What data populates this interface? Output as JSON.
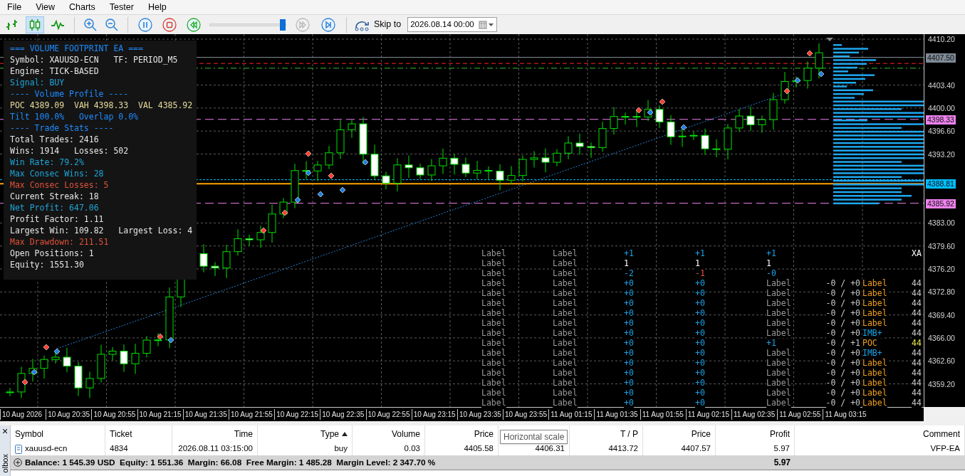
{
  "menu": [
    "File",
    "View",
    "Charts",
    "Tester",
    "Help"
  ],
  "toolbar": {
    "chart_types": [
      {
        "kind": "bars",
        "selected": false
      },
      {
        "kind": "candles",
        "selected": true
      },
      {
        "kind": "line",
        "selected": false
      }
    ],
    "playback": [
      {
        "kind": "pause",
        "disabled": false
      },
      {
        "kind": "stop",
        "disabled": false
      },
      {
        "kind": "rewind",
        "disabled": false
      }
    ],
    "speed": {
      "level": 0.95
    },
    "steps": [
      {
        "kind": "fast-forward",
        "disabled": true
      },
      {
        "kind": "step-end",
        "disabled": false
      }
    ],
    "skip_label": "Skip to",
    "skip_date": "2026.08.14 00:00"
  },
  "info_panel": [
    {
      "text": "=== VOLUME FOOTPRINT EA ===",
      "color": "#1e8cff"
    },
    {
      "text": "Symbol: XAUUSD-ECN   TF: PERIOD_M5",
      "color": "#e6e6e6"
    },
    {
      "text": "Engine: TICK-BASED",
      "color": "#e6e6e6"
    },
    {
      "text": "Signal: BUY",
      "color": "#1ea5d8"
    },
    {
      "text": "---- Volume Profile ----",
      "color": "#1e8cff"
    },
    {
      "text": "POC 4389.09  VAH 4398.33  VAL 4385.92",
      "color": "#e6dc9c"
    },
    {
      "text": "Tilt 100.0%   Overlap 0.0%",
      "color": "#1e8cff"
    },
    {
      "text": "---- Trade Stats ----",
      "color": "#1e8cff"
    },
    {
      "text": "Total Trades: 2416",
      "color": "#e6e6e6"
    },
    {
      "text": "Wins: 1914   Losses: 502",
      "color": "#e6e6e6"
    },
    {
      "text": "Win Rate: 79.2%",
      "color": "#1ea5d8"
    },
    {
      "text": "Max Consec Wins: 28",
      "color": "#1ea5d8"
    },
    {
      "text": "Max Consec Losses: 5",
      "color": "#e0523a"
    },
    {
      "text": "Current Streak: 18",
      "color": "#e6e6e6"
    },
    {
      "text": "Net Profit: 647.06",
      "color": "#1ea5d8"
    },
    {
      "text": "Profit Factor: 1.11",
      "color": "#e6e6e6"
    },
    {
      "text": "Largest Win: 109.82   Largest Loss: 4",
      "color": "#e6e6e6"
    },
    {
      "text": "Max Drawdown: 211.51",
      "color": "#e0523a"
    },
    {
      "text": "Open Positions: 1",
      "color": "#e6e6e6"
    },
    {
      "text": "Equity: 1551.30",
      "color": "#e6e6e6"
    }
  ],
  "label_grid": [
    {
      "column_1": {
        "text": "Label",
        "color": "#9a9a9a"
      },
      "column_2": {
        "text": "Label",
        "color": "#9a9a9a"
      },
      "column_3": {
        "text": "+1",
        "color": "#1aa3e8"
      },
      "column_4": {
        "text": "+1",
        "color": "#1aa3e8"
      },
      "column_5": {
        "text": "+1",
        "color": "#1aa3e8"
      },
      "column_8": {
        "text": "XA",
        "color": "#ffffff"
      }
    },
    {
      "column_1": {
        "text": "Label",
        "color": "#9a9a9a"
      },
      "column_2": {
        "text": "Label",
        "color": "#9a9a9a"
      },
      "column_3": {
        "text": "1",
        "color": "#ffffff"
      },
      "column_4": {
        "text": "1",
        "color": "#ffffff"
      },
      "column_5": {
        "text": "1",
        "color": "#ffffff"
      }
    },
    {
      "column_1": {
        "text": "Label",
        "color": "#9a9a9a"
      },
      "column_2": {
        "text": "Label",
        "color": "#9a9a9a"
      },
      "column_3": {
        "text": "-2",
        "color": "#1aa3e8"
      },
      "column_4": {
        "text": "-1",
        "color": "#e8543a"
      },
      "column_5": {
        "text": "-0",
        "color": "#1aa3e8"
      }
    },
    {
      "column_1": {
        "text": "Label",
        "color": "#9a9a9a"
      },
      "column_2": {
        "text": "Label",
        "color": "#9a9a9a"
      },
      "column_3": {
        "text": "+0",
        "color": "#1aa3e8"
      },
      "column_4": {
        "text": "+0",
        "color": "#1aa3e8"
      },
      "column_5": {
        "text": "Label",
        "color": "#9a9a9a"
      },
      "column_6": {
        "text": "-0 / +0",
        "color": "#c8c8c8"
      },
      "column_7": {
        "text": "Label",
        "color": "#f0a020"
      },
      "column_8": {
        "text": "44",
        "color": "#c8c8c8"
      }
    },
    {
      "column_1": {
        "text": "Label",
        "color": "#9a9a9a"
      },
      "column_2": {
        "text": "Label",
        "color": "#9a9a9a"
      },
      "column_3": {
        "text": "+0",
        "color": "#1aa3e8"
      },
      "column_4": {
        "text": "+0",
        "color": "#1aa3e8"
      },
      "column_5": {
        "text": "Label",
        "color": "#9a9a9a"
      },
      "column_6": {
        "text": "-0 / +0",
        "color": "#c8c8c8"
      },
      "column_7": {
        "text": "Label",
        "color": "#f0a020"
      },
      "column_8": {
        "text": "44",
        "color": "#c8c8c8"
      }
    },
    {
      "column_1": {
        "text": "Label",
        "color": "#9a9a9a"
      },
      "column_2": {
        "text": "Label",
        "color": "#9a9a9a"
      },
      "column_3": {
        "text": "+0",
        "color": "#1aa3e8"
      },
      "column_4": {
        "text": "+0",
        "color": "#1aa3e8"
      },
      "column_5": {
        "text": "Label",
        "color": "#9a9a9a"
      },
      "column_6": {
        "text": "-0 / +0",
        "color": "#c8c8c8"
      },
      "column_7": {
        "text": "Label",
        "color": "#f0a020"
      },
      "column_8": {
        "text": "44",
        "color": "#c8c8c8"
      }
    },
    {
      "column_1": {
        "text": "Label",
        "color": "#9a9a9a"
      },
      "column_2": {
        "text": "Label",
        "color": "#9a9a9a"
      },
      "column_3": {
        "text": "+0",
        "color": "#1aa3e8"
      },
      "column_4": {
        "text": "+0",
        "color": "#1aa3e8"
      },
      "column_5": {
        "text": "Label",
        "color": "#9a9a9a"
      },
      "column_6": {
        "text": "-0 / +0",
        "color": "#c8c8c8"
      },
      "column_7": {
        "text": "Label",
        "color": "#f0a020"
      },
      "column_8": {
        "text": "44",
        "color": "#c8c8c8"
      }
    },
    {
      "column_1": {
        "text": "Label",
        "color": "#9a9a9a"
      },
      "column_2": {
        "text": "Label",
        "color": "#9a9a9a"
      },
      "column_3": {
        "text": "+0",
        "color": "#1aa3e8"
      },
      "column_4": {
        "text": "+0",
        "color": "#1aa3e8"
      },
      "column_5": {
        "text": "Label",
        "color": "#9a9a9a"
      },
      "column_6": {
        "text": "-0 / +0",
        "color": "#c8c8c8"
      },
      "column_7": {
        "text": "Label",
        "color": "#f0a020"
      },
      "column_8": {
        "text": "44",
        "color": "#c8c8c8"
      }
    },
    {
      "column_1": {
        "text": "Label",
        "color": "#9a9a9a"
      },
      "column_2": {
        "text": "Label",
        "color": "#9a9a9a"
      },
      "column_3": {
        "text": "+0",
        "color": "#1aa3e8"
      },
      "column_4": {
        "text": "+0",
        "color": "#1aa3e8"
      },
      "column_5": {
        "text": "Label",
        "color": "#9a9a9a"
      },
      "column_6": {
        "text": "-0 / +0",
        "color": "#c8c8c8"
      },
      "column_7": {
        "text": "IMB+",
        "color": "#1aa3e8"
      },
      "column_8": {
        "text": "44",
        "color": "#c8c8c8"
      }
    },
    {
      "column_1": {
        "text": "Label",
        "color": "#9a9a9a"
      },
      "column_2": {
        "text": "Label",
        "color": "#9a9a9a"
      },
      "column_3": {
        "text": "+0",
        "color": "#1aa3e8"
      },
      "column_4": {
        "text": "+0",
        "color": "#1aa3e8"
      },
      "column_5": {
        "text": "+1",
        "color": "#1aa3e8"
      },
      "column_6": {
        "text": "-0 / +1",
        "color": "#c8c8c8"
      },
      "column_7": {
        "text": "POC",
        "color": "#f0a020"
      },
      "column_8": {
        "text": "44",
        "color": "#e8e84a"
      }
    },
    {
      "column_1": {
        "text": "Label",
        "color": "#9a9a9a"
      },
      "column_2": {
        "text": "Label",
        "color": "#9a9a9a"
      },
      "column_3": {
        "text": "+0",
        "color": "#1aa3e8"
      },
      "column_4": {
        "text": "+0",
        "color": "#1aa3e8"
      },
      "column_5": {
        "text": "Label",
        "color": "#9a9a9a"
      },
      "column_6": {
        "text": "-0 / +0",
        "color": "#c8c8c8"
      },
      "column_7": {
        "text": "IMB+",
        "color": "#1aa3e8"
      },
      "column_8": {
        "text": "44",
        "color": "#c8c8c8"
      }
    },
    {
      "column_1": {
        "text": "Label",
        "color": "#9a9a9a"
      },
      "column_2": {
        "text": "Label",
        "color": "#9a9a9a"
      },
      "column_3": {
        "text": "+0",
        "color": "#1aa3e8"
      },
      "column_4": {
        "text": "+0",
        "color": "#1aa3e8"
      },
      "column_5": {
        "text": "Label",
        "color": "#9a9a9a"
      },
      "column_6": {
        "text": "-0 / +0",
        "color": "#c8c8c8"
      },
      "column_7": {
        "text": "Label",
        "color": "#f0a020"
      },
      "column_8": {
        "text": "44",
        "color": "#c8c8c8"
      }
    },
    {
      "column_1": {
        "text": "Label",
        "color": "#9a9a9a"
      },
      "column_2": {
        "text": "Label",
        "color": "#9a9a9a"
      },
      "column_3": {
        "text": "+0",
        "color": "#1aa3e8"
      },
      "column_4": {
        "text": "+0",
        "color": "#1aa3e8"
      },
      "column_5": {
        "text": "Label",
        "color": "#9a9a9a"
      },
      "column_6": {
        "text": "-0 / +0",
        "color": "#c8c8c8"
      },
      "column_7": {
        "text": "Label",
        "color": "#f0a020"
      },
      "column_8": {
        "text": "44",
        "color": "#c8c8c8"
      }
    },
    {
      "column_1": {
        "text": "Label",
        "color": "#9a9a9a"
      },
      "column_2": {
        "text": "Label",
        "color": "#9a9a9a"
      },
      "column_3": {
        "text": "+0",
        "color": "#1aa3e8"
      },
      "column_4": {
        "text": "+0",
        "color": "#1aa3e8"
      },
      "column_5": {
        "text": "Label",
        "color": "#9a9a9a"
      },
      "column_6": {
        "text": "-0 / +0",
        "color": "#c8c8c8"
      },
      "column_7": {
        "text": "Label",
        "color": "#f0a020"
      },
      "column_8": {
        "text": "44",
        "color": "#c8c8c8"
      }
    },
    {
      "column_1": {
        "text": "Label",
        "color": "#9a9a9a"
      },
      "column_2": {
        "text": "Label",
        "color": "#9a9a9a"
      },
      "column_3": {
        "text": "+0",
        "color": "#1aa3e8"
      },
      "column_4": {
        "text": "+0",
        "color": "#1aa3e8"
      },
      "column_5": {
        "text": "Label",
        "color": "#9a9a9a"
      },
      "column_6": {
        "text": "-0 / +0",
        "color": "#c8c8c8"
      },
      "column_7": {
        "text": "Label",
        "color": "#f0a020"
      },
      "column_8": {
        "text": "44",
        "color": "#c8c8c8"
      }
    },
    {
      "column_1": {
        "text": "Label",
        "color": "#9a9a9a"
      },
      "column_2": {
        "text": "Label",
        "color": "#9a9a9a"
      },
      "column_3": {
        "text": "+0",
        "color": "#1aa3e8"
      },
      "column_4": {
        "text": "+0",
        "color": "#1aa3e8"
      },
      "column_5": {
        "text": "Label",
        "color": "#9a9a9a"
      },
      "column_6": {
        "text": "-0 / +0",
        "color": "#c8c8c8"
      },
      "column_7": {
        "text": "Label",
        "color": "#f0a020"
      },
      "column_8": {
        "text": "44",
        "color": "#c8c8c8"
      }
    }
  ],
  "price_axis": [
    "4410.20",
    "4403.40",
    "4400.00",
    "4396.60",
    "4393.20",
    "4383.00",
    "4379.60",
    "4376.20",
    "4372.80",
    "4369.40",
    "4366.00",
    "4362.60",
    "4359.20"
  ],
  "price_tags": [
    {
      "text": "4407.50",
      "color": "#7f8a96"
    },
    {
      "text": "4398.33",
      "color": "#ee82ee"
    },
    {
      "text": "4388.81",
      "color": "#00bfff"
    },
    {
      "text": "4385.92",
      "color": "#ee82ee"
    }
  ],
  "time_axis": [
    "10 Aug 2026",
    "10 Aug 20:35",
    "10 Aug 20:55",
    "10 Aug 21:15",
    "10 Aug 21:35",
    "10 Aug 21:55",
    "10 Aug 22:15",
    "10 Aug 22:35",
    "10 Aug 22:55",
    "10 Aug 23:15",
    "10 Aug 23:35",
    "10 Aug 23:55",
    "11 Aug 01:15",
    "11 Aug 01:35",
    "11 Aug 01:55",
    "11 Aug 02:15",
    "11 Aug 02:35",
    "11 Aug 02:55",
    "11 Aug 03:15"
  ],
  "toolbox": {
    "close": "×",
    "tab": "olbox"
  },
  "table": {
    "columns": [
      {
        "text": "Symbol",
        "sorted": false
      },
      {
        "text": "Ticket",
        "sorted": false
      },
      {
        "text": "Time",
        "sorted": false
      },
      {
        "text": "Type",
        "sorted": true
      },
      {
        "text": "Volume",
        "sorted": false
      },
      {
        "text": "Price",
        "sorted": false
      },
      {
        "text": ""
      },
      {
        "text": "T / P",
        "sorted": false
      },
      {
        "text": "Price",
        "sorted": false
      },
      {
        "text": "Profit",
        "sorted": false
      },
      {
        "text": "Comment",
        "sorted": false
      }
    ],
    "rows": [
      [
        "xauusd-ecn",
        "4834",
        "2026.08.11 03:15:00",
        "buy",
        "0.03",
        "4405.58",
        "4406.31",
        "4413.72",
        "4407.57",
        "5.97",
        "VFP-EA"
      ]
    ],
    "summary": "Balance: 1 545.39 USD  Equity: 1 551.36  Margin: 66.08  Free Margin: 1 485.28  Margin Level: 2 347.70 %",
    "summary_profit": "5.97"
  },
  "tooltip": "Horizontal scale"
}
